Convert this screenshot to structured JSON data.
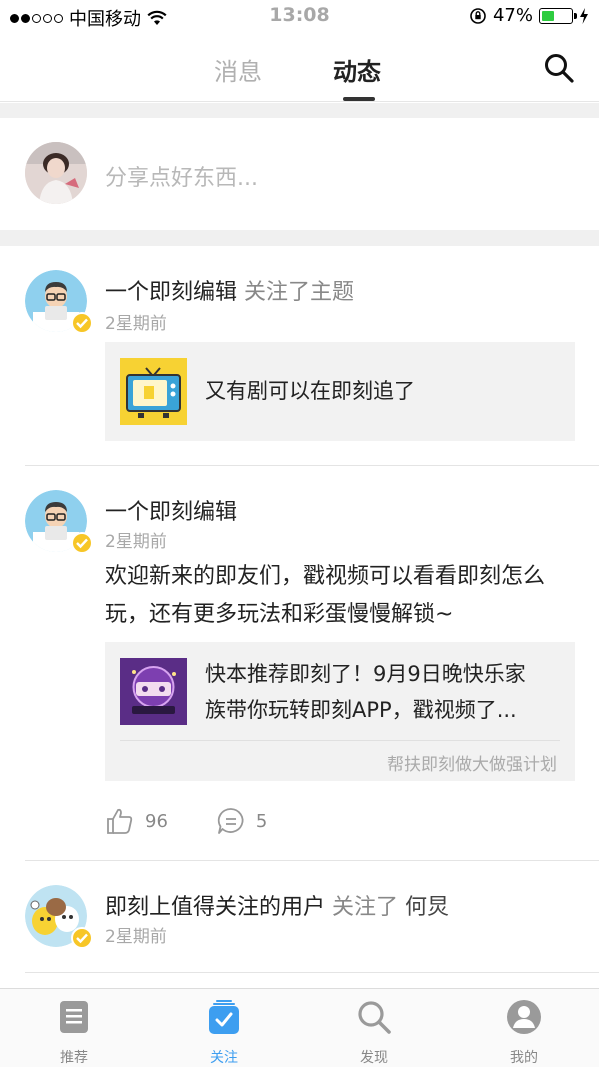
{
  "status_bar": {
    "carrier": "中国移动",
    "time": "13:08",
    "battery_percent": "47%",
    "battery_level": 0.47
  },
  "top_nav": {
    "tabs": [
      {
        "label": "消息",
        "active": false
      },
      {
        "label": "动态",
        "active": true
      }
    ],
    "search_icon": "search-icon"
  },
  "composer": {
    "placeholder": "分享点好东西..."
  },
  "feed": [
    {
      "author": "一个即刻编辑",
      "action": "关注了主题",
      "time": "2星期前",
      "card": {
        "text": "又有剧可以在即刻追了",
        "thumb_icon": "tv-icon"
      }
    },
    {
      "author": "一个即刻编辑",
      "time": "2星期前",
      "body": "欢迎新来的即友们，戳视频可以看看即刻怎么玩，还有更多玩法和彩蛋慢慢解锁~",
      "card": {
        "text_line1": "快本推荐即刻了！9月9日晚快乐家",
        "text_line2": "族带你玩转即刻APP，戳视频了...",
        "source": "帮扶即刻做大做强计划"
      },
      "likes": "96",
      "comments": "5"
    },
    {
      "author": "即刻上值得关注的用户",
      "action": "关注了",
      "target": "何炅",
      "time": "2星期前"
    }
  ],
  "tab_bar": {
    "items": [
      {
        "label": "推荐",
        "icon": "recommend-icon",
        "active": false
      },
      {
        "label": "关注",
        "icon": "follow-icon",
        "active": true
      },
      {
        "label": "发现",
        "icon": "discover-icon",
        "active": false
      },
      {
        "label": "我的",
        "icon": "profile-icon",
        "active": false
      }
    ]
  },
  "colors": {
    "accent": "#3d9ef0",
    "verified": "#f7c627",
    "battery": "#2ecc40"
  }
}
